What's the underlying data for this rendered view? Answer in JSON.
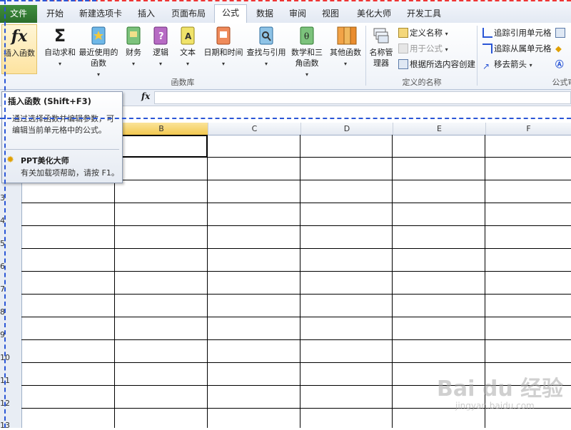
{
  "tabs": {
    "file": "文件",
    "items": [
      {
        "label": "开始"
      },
      {
        "label": "新建选项卡"
      },
      {
        "label": "插入"
      },
      {
        "label": "页面布局"
      },
      {
        "label": "公式",
        "active": true
      },
      {
        "label": "数据"
      },
      {
        "label": "审阅"
      },
      {
        "label": "视图"
      },
      {
        "label": "美化大师"
      },
      {
        "label": "开发工具"
      }
    ]
  },
  "ribbon": {
    "function_library": {
      "group_label": "函数库",
      "insert_function": "插入函数",
      "autosum": "自动求和",
      "recent": "最近使用的函数",
      "financial": "财务",
      "logical": "逻辑",
      "text": "文本",
      "datetime": "日期和时间",
      "lookup": "查找与引用",
      "math": "数学和三角函数",
      "more": "其他函数"
    },
    "defined_names": {
      "group_label": "定义的名称",
      "name_manager": "名称管理器",
      "define_name": "定义名称",
      "use_in_formula": "用于公式",
      "create_from_selection": "根据所选内容创建"
    },
    "auditing": {
      "group_label": "公式审",
      "trace_precedents": "追踪引用单元格",
      "trace_dependents": "追踪从属单元格",
      "remove_arrows": "移去箭头"
    }
  },
  "formula_bar": {
    "fx": "fx"
  },
  "tooltip": {
    "title": "插入函数 (Shift+F3)",
    "description": "通过选择函数并编辑参数，可编辑当前单元格中的公式。",
    "help_title": "PPT美化大师",
    "help_text": "有关加载项帮助，请按 F1。"
  },
  "grid": {
    "columns": [
      "B",
      "C",
      "D",
      "E",
      "F"
    ],
    "selected_column": "B",
    "rows": [
      "3",
      "4",
      "5",
      "6",
      "7",
      "8",
      "9",
      "10",
      "11",
      "12",
      "13"
    ]
  },
  "watermark": {
    "main": "Bai du 经验",
    "sub": "jingyan.baidu.com"
  },
  "colors": {
    "file_tab": "#2c6e2c",
    "selection_header": "#f2c850",
    "dash_blue": "#2a56d6",
    "dash_red": "#e33333"
  }
}
